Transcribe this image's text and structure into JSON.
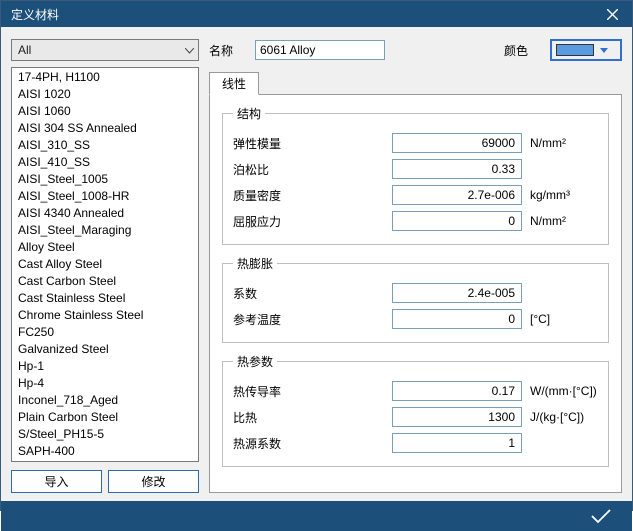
{
  "window": {
    "title": "定义材料"
  },
  "filter": {
    "selected": "All"
  },
  "materials": [
    "17-4PH, H1100",
    "AISI 1020",
    "AISI 1060",
    "AISI 304 SS Annealed",
    "AISI_310_SS",
    "AISI_410_SS",
    "AISI_Steel_1005",
    "AISI_Steel_1008-HR",
    "AISI 4340 Annealed",
    "AISI_Steel_Maraging",
    "Alloy Steel",
    "Cast Alloy Steel",
    "Cast Carbon Steel",
    "Cast Stainless Steel",
    "Chrome Stainless Steel",
    "FC250",
    "Galvanized Steel",
    "Hp-1",
    "Hp-4",
    "Inconel_718_Aged",
    "Plain Carbon Steel",
    "S/Steel_PH15-5",
    "SAPH-400"
  ],
  "buttons": {
    "import": "导入",
    "modify": "修改"
  },
  "labels": {
    "name": "名称",
    "color": "颜色"
  },
  "name_value": "6061 Alloy",
  "color_value": "#5a9be0",
  "tabs": {
    "linear": "线性"
  },
  "groups": {
    "structure": {
      "legend": "结构",
      "rows": [
        {
          "label": "弹性模量",
          "value": "69000",
          "unit": "N/mm²"
        },
        {
          "label": "泊松比",
          "value": "0.33",
          "unit": ""
        },
        {
          "label": "质量密度",
          "value": "2.7e-006",
          "unit": "kg/mm³"
        },
        {
          "label": "屈服应力",
          "value": "0",
          "unit": "N/mm²"
        }
      ]
    },
    "thermal_exp": {
      "legend": "热膨胀",
      "rows": [
        {
          "label": "系数",
          "value": "2.4e-005",
          "unit": ""
        },
        {
          "label": "参考温度",
          "value": "0",
          "unit": "[°C]"
        }
      ]
    },
    "thermal_param": {
      "legend": "热参数",
      "rows": [
        {
          "label": "热传导率",
          "value": "0.17",
          "unit": "W/(mm·[°C])"
        },
        {
          "label": "比热",
          "value": "1300",
          "unit": "J/(kg·[°C])"
        },
        {
          "label": "热源系数",
          "value": "1",
          "unit": ""
        }
      ]
    }
  }
}
